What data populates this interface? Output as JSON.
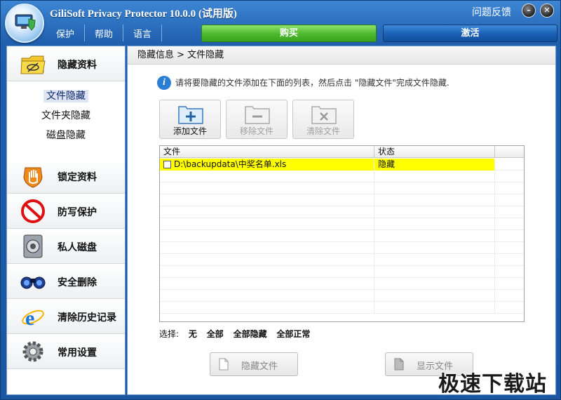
{
  "app": {
    "title": "GiliSoft Privacy Protector 10.0.0 (试用版)"
  },
  "titlebar": {
    "feedback_label": "问题反馈",
    "minimize_icon": "minimize-icon",
    "close_icon": "close-icon"
  },
  "menu": {
    "items": [
      {
        "label": "保护"
      },
      {
        "label": "帮助"
      },
      {
        "label": "语言"
      }
    ],
    "buy_label": "购买",
    "activate_label": "激活"
  },
  "sidebar": {
    "items": [
      {
        "label": "隐藏资料",
        "icon": "hide-folder-icon"
      },
      {
        "label": "锁定资料",
        "icon": "lock-hand-icon"
      },
      {
        "label": "防写保护",
        "icon": "no-entry-icon"
      },
      {
        "label": "私人磁盘",
        "icon": "safe-disk-icon"
      },
      {
        "label": "安全删除",
        "icon": "binoculars-icon"
      },
      {
        "label": "清除历史记录",
        "icon": "ie-icon"
      },
      {
        "label": "常用设置",
        "icon": "gear-icon"
      }
    ],
    "subitems": [
      {
        "label": "文件隐藏",
        "active": true
      },
      {
        "label": "文件夹隐藏"
      },
      {
        "label": "磁盘隐藏"
      }
    ]
  },
  "main": {
    "breadcrumb": "隐藏信息 > 文件隐藏",
    "info": "请将要隐藏的文件添加在下面的列表，然后点击 \"隐藏文件\"完成文件隐藏.",
    "toolbar": {
      "add_label": "添加文件",
      "remove_label": "移除文件",
      "clear_label": "清除文件"
    },
    "table": {
      "columns": [
        "文件",
        "状态"
      ],
      "rows": [
        {
          "file": "D:\\backupdata\\中奖名单.xls",
          "status": "隐藏",
          "checked": false
        }
      ]
    },
    "select": {
      "label": "选择:",
      "options": [
        "无",
        "全部",
        "全部隐藏",
        "全部正常"
      ]
    },
    "hide_button": "隐藏文件",
    "show_button": "显示文件"
  },
  "watermark": "极速下载站",
  "colors": {
    "buy": "#4cb82e",
    "activate": "#1a5fb4",
    "highlight": "#ffff00",
    "titlebar": "#1f5fae"
  }
}
